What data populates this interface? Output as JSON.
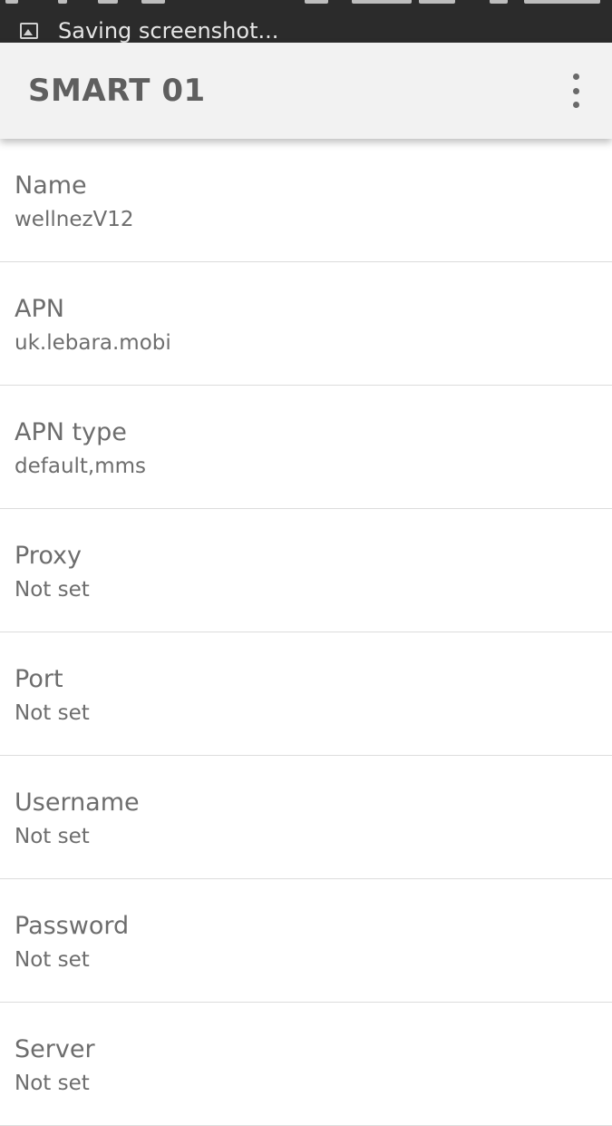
{
  "status_bar": {
    "notification_text": "Saving screenshot..."
  },
  "app_bar": {
    "title": "SMART 01"
  },
  "preferences": [
    {
      "title": "Name",
      "summary": "wellnezV12"
    },
    {
      "title": "APN",
      "summary": "uk.lebara.mobi"
    },
    {
      "title": "APN type",
      "summary": "default,mms"
    },
    {
      "title": "Proxy",
      "summary": "Not set"
    },
    {
      "title": "Port",
      "summary": "Not set"
    },
    {
      "title": "Username",
      "summary": "Not set"
    },
    {
      "title": "Password",
      "summary": "Not set"
    },
    {
      "title": "Server",
      "summary": "Not set"
    }
  ]
}
